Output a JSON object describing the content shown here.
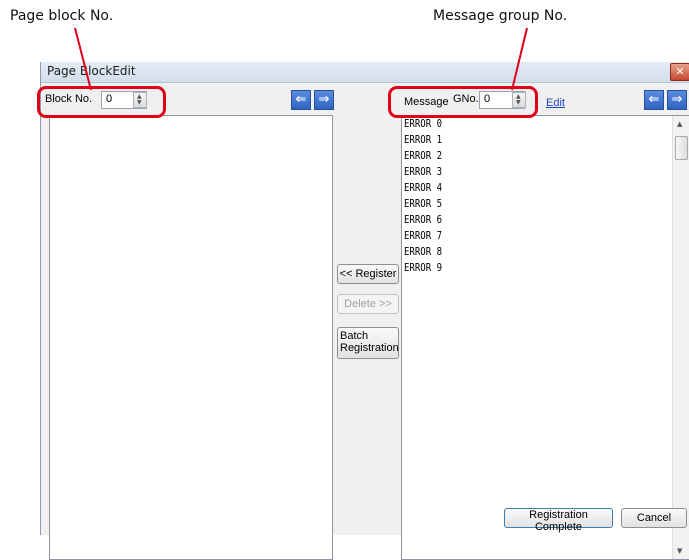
{
  "callouts": {
    "page_block_label": "Page block No.",
    "message_group_label": "Message group No."
  },
  "window": {
    "title": "Page BlockEdit",
    "close_glyph": "✕"
  },
  "left_panel": {
    "block_label": "Block No.",
    "block_value": "0"
  },
  "right_panel": {
    "message_label": "Message",
    "gno_label": "GNo.",
    "gno_value": "0",
    "edit_link": "Edit",
    "items": [
      "ERROR 0",
      "ERROR 1",
      "ERROR 2",
      "ERROR 3",
      "ERROR 4",
      "ERROR 5",
      "ERROR 6",
      "ERROR 7",
      "ERROR 8",
      "ERROR 9"
    ]
  },
  "middle_buttons": {
    "register": "<< Register",
    "delete": "Delete >>",
    "batch_line1": "Batch",
    "batch_line2": "Registration"
  },
  "footer": {
    "complete": "Registration Complete",
    "cancel": "Cancel"
  },
  "icons": {
    "nav_left": "arrow-left-icon",
    "nav_right": "arrow-right-icon"
  },
  "colors": {
    "callout_red": "#e0001a",
    "nav_blue": "#2e63c4",
    "link_blue": "#1b47c5"
  }
}
